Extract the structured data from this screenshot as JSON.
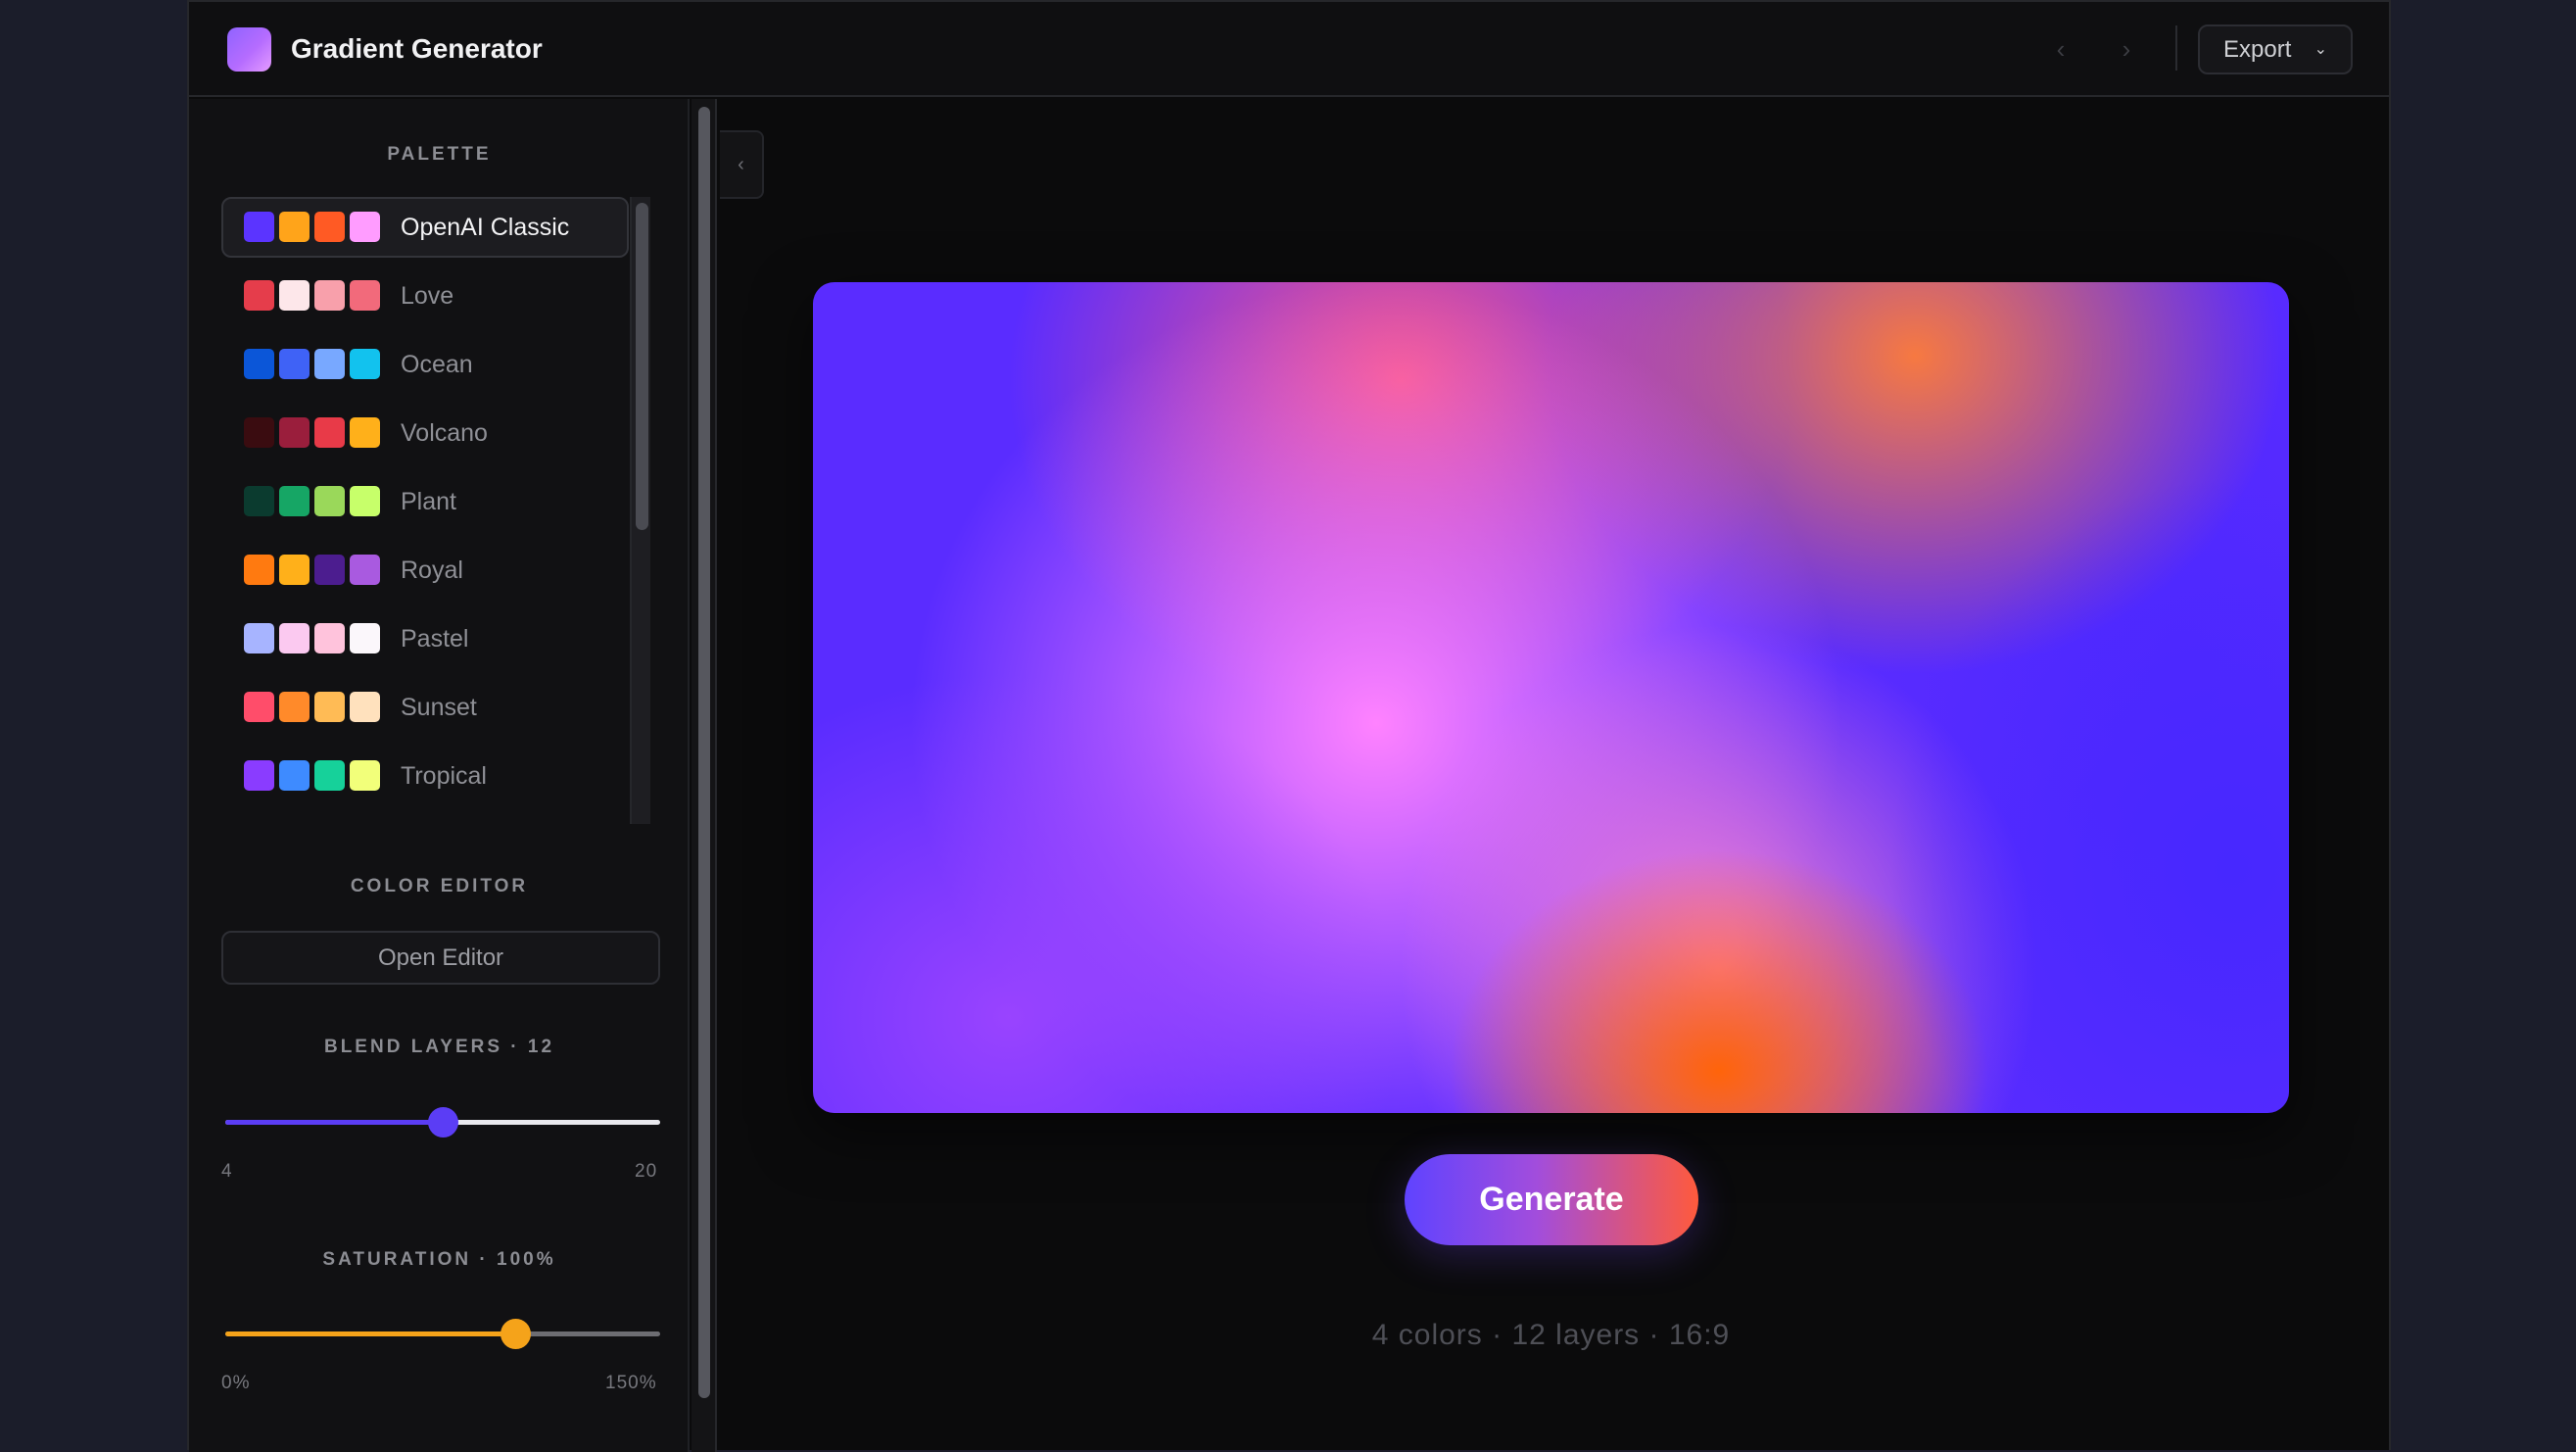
{
  "app": {
    "title": "Gradient Generator"
  },
  "toolbar": {
    "back_icon": "chevron-left-icon",
    "forward_icon": "chevron-right-icon",
    "export_label": "Export",
    "export_chevron": "chevron-down-icon"
  },
  "sidebar": {
    "palette_title": "PALETTE",
    "palettes": [
      {
        "name": "OpenAI Classic",
        "selected": true,
        "colors": [
          "#5b34ff",
          "#ffa41a",
          "#ff5a24",
          "#ff9cff"
        ]
      },
      {
        "name": "Love",
        "selected": false,
        "colors": [
          "#e53d4b",
          "#fde7ea",
          "#f8a0ab",
          "#f26a7b"
        ]
      },
      {
        "name": "Ocean",
        "selected": false,
        "colors": [
          "#0b56d8",
          "#3f62f6",
          "#78a8ff",
          "#12c2ee"
        ]
      },
      {
        "name": "Volcano",
        "selected": false,
        "colors": [
          "#3a0c10",
          "#9a1e3c",
          "#e83a48",
          "#ffb01a"
        ]
      },
      {
        "name": "Plant",
        "selected": false,
        "colors": [
          "#0b3b2f",
          "#16a665",
          "#9ad85a",
          "#c7ff6a"
        ]
      },
      {
        "name": "Royal",
        "selected": false,
        "colors": [
          "#ff7a10",
          "#ffb01a",
          "#4c1d8f",
          "#a95ae0"
        ]
      },
      {
        "name": "Pastel",
        "selected": false,
        "colors": [
          "#a7b4ff",
          "#fbc9f0",
          "#ffc3dc",
          "#fbf7fb"
        ]
      },
      {
        "name": "Sunset",
        "selected": false,
        "colors": [
          "#ff4d6a",
          "#ff8a2a",
          "#ffbb55",
          "#ffe1bd"
        ]
      },
      {
        "name": "Tropical",
        "selected": false,
        "colors": [
          "#8a3cff",
          "#3e8bff",
          "#16d19a",
          "#f2ff7a"
        ]
      }
    ],
    "color_editor_title": "COLOR EDITOR",
    "open_editor_label": "Open Editor",
    "blend_layers_title": "BLEND LAYERS · 12",
    "blend_layers": {
      "value": 12,
      "min": 4,
      "max": 20,
      "min_label": "4",
      "max_label": "20",
      "accent": "#5b3df5"
    },
    "saturation_title": "SATURATION · 100%",
    "saturation": {
      "value": 100,
      "min": 0,
      "max": 150,
      "min_label": "0%",
      "max_label": "150%",
      "accent": "#f5a31a"
    },
    "collapse_icon": "chevron-left-icon"
  },
  "main": {
    "generate_label": "Generate",
    "status": "4 colors · 12 layers · 16:9"
  }
}
